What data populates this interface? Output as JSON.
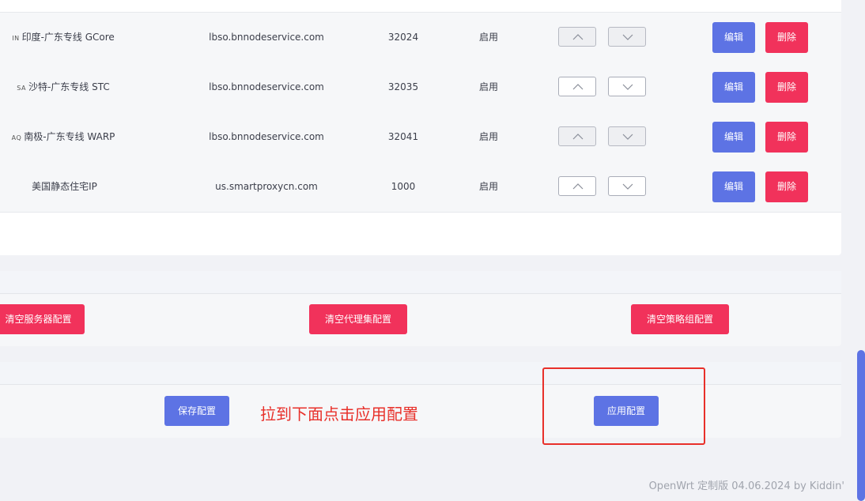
{
  "table": {
    "rows": [
      {
        "flag": "IN",
        "name": "印度-广东专线 GCore",
        "host": "lbso.bnnodeservice.com",
        "port": "32024",
        "status": "启用",
        "up_disabled": true,
        "down_disabled": true
      },
      {
        "flag": "SA",
        "name": "沙特-广东专线 STC",
        "host": "lbso.bnnodeservice.com",
        "port": "32035",
        "status": "启用",
        "up_disabled": false,
        "down_disabled": false
      },
      {
        "flag": "AQ",
        "name": "南极-广东专线 WARP",
        "host": "lbso.bnnodeservice.com",
        "port": "32041",
        "status": "启用",
        "up_disabled": true,
        "down_disabled": true
      },
      {
        "flag": "",
        "name": "美国静态住宅IP",
        "host": "us.smartproxycn.com",
        "port": "1000",
        "status": "启用",
        "up_disabled": false,
        "down_disabled": false
      }
    ],
    "edit_label": "编辑",
    "delete_label": "删除"
  },
  "actions": {
    "clear_servers": "清空服务器配置",
    "clear_proxy_sets": "清空代理集配置",
    "clear_policy_groups": "清空策略组配置"
  },
  "save": {
    "save_label": "保存配置",
    "apply_label": "应用配置",
    "annotation": "拉到下面点击应用配置"
  },
  "footer": {
    "text": "OpenWrt 定制版 04.06.2024 by Kiddin'"
  },
  "colors": {
    "primary": "#5d73e4",
    "danger": "#f1325b",
    "annotation": "#e8302a"
  }
}
